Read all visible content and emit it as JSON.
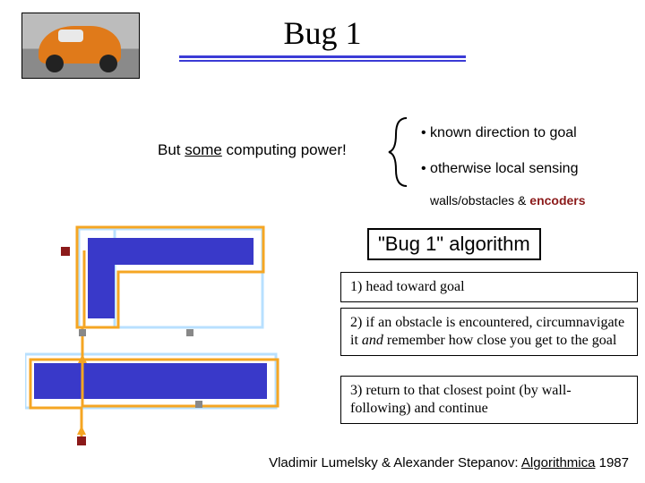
{
  "title": "Bug 1",
  "power_prefix": "But ",
  "power_underlined": "some",
  "power_suffix": " computing power!",
  "req1": "• known direction to goal",
  "req2": "• otherwise local sensing",
  "req_detail_plain": "walls/obstacles  &  ",
  "req_detail_maroon": "encoders",
  "algo_title": "\"Bug 1\" algorithm",
  "step1": "1) head toward goal",
  "step2_a": "2) if an obstacle is encountered, circumnavigate it ",
  "step2_and": "and",
  "step2_b": " remember how close you get to the goal",
  "step3": "3) return to that closest point (by wall-following) and continue",
  "citation_authors": "Vladimir Lumelsky & Alexander Stepanov:  ",
  "citation_source": "Algorithmica",
  "citation_year": " 1987"
}
